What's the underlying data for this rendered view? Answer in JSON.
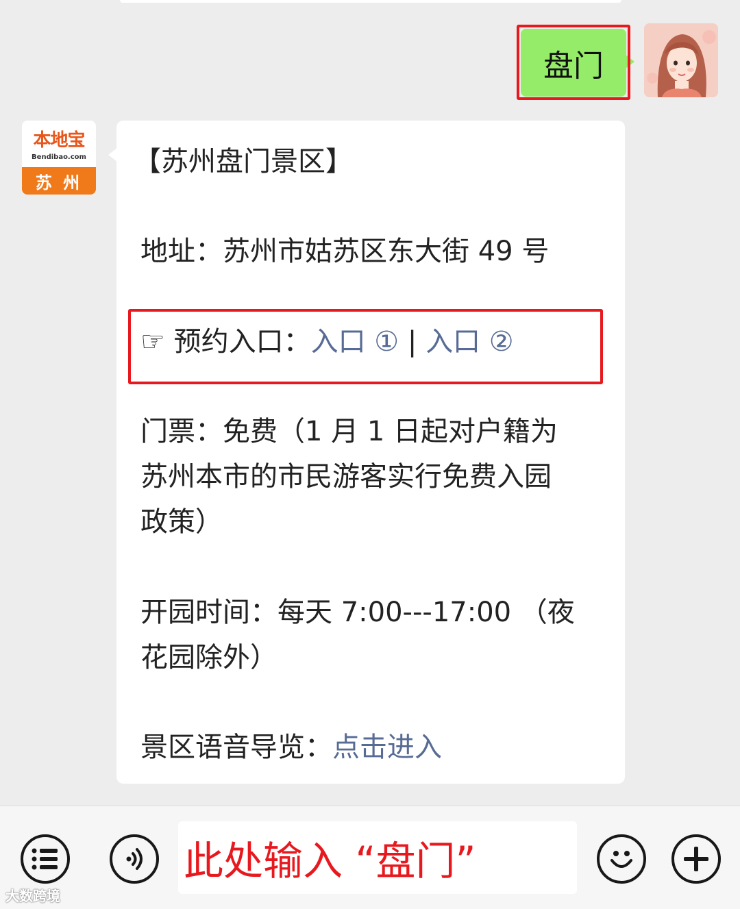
{
  "outgoing": {
    "text": "盘门"
  },
  "bot": {
    "logo_brand": "本地宝",
    "logo_domain": "Bendibao.com",
    "logo_city": "苏 州"
  },
  "message": {
    "title": "【苏州盘门景区】",
    "address_label": "地址：",
    "address_value": "苏州市姑苏区东大街 49 号",
    "booking_icon": "☞",
    "booking_label": "预约入口：",
    "booking_link_1": "入口 ①",
    "booking_sep": " | ",
    "booking_link_2": "入口 ②",
    "ticket_line_1": "门票：免费（1 月 1 日起对户籍为",
    "ticket_line_2": "苏州本市的市民游客实行免费入园",
    "ticket_line_3": "政策）",
    "hours_line_1": "开园时间：每天 7:00---17:00 （夜",
    "hours_line_2": "花园除外）",
    "guide_label": "景区语音导览：",
    "guide_link": "点击进入"
  },
  "input_bar": {
    "menu_icon": "list-icon",
    "voice_icon": "voice-icon",
    "input_text": "此处输入 “盘门”",
    "emoji_icon": "emoji-icon",
    "plus_icon": "plus-icon"
  },
  "watermark": "大数跨境",
  "colors": {
    "accent_red": "#e8191e",
    "bubble_green": "#95ec69",
    "link": "#576b95"
  }
}
